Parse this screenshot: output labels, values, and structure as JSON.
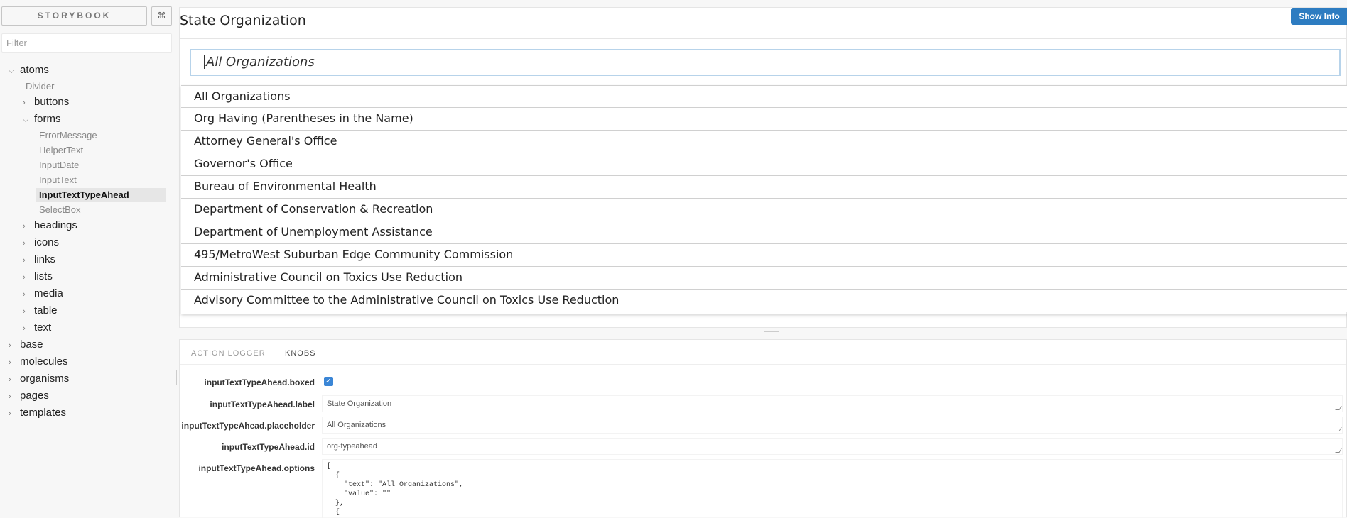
{
  "sidebar": {
    "brand": "STORYBOOK",
    "shortcut": "⌘",
    "filter_placeholder": "Filter",
    "tree": {
      "atoms": "atoms",
      "divider": "Divider",
      "buttons": "buttons",
      "forms": "forms",
      "forms_items": [
        "ErrorMessage",
        "HelperText",
        "InputDate",
        "InputText",
        "InputTextTypeAhead",
        "SelectBox"
      ],
      "headings": "headings",
      "icons": "icons",
      "links": "links",
      "lists": "lists",
      "media": "media",
      "table": "table",
      "text": "text",
      "base": "base",
      "molecules": "molecules",
      "organisms": "organisms",
      "pages": "pages",
      "templates": "templates"
    },
    "selected_story": "InputTextTypeAhead"
  },
  "preview": {
    "title": "State Organization",
    "show_info": "Show Info",
    "input_value": "All Organizations",
    "options": [
      "All Organizations",
      "Org Having (Parentheses in the Name)",
      "Attorney General's Office",
      "Governor's Office",
      "Bureau of Environmental Health",
      "Department of Conservation & Recreation",
      "Department of Unemployment Assistance",
      "495/MetroWest Suburban Edge Community Commission",
      "Administrative Council on Toxics Use Reduction",
      "Advisory Committee to the Administrative Council on Toxics Use Reduction"
    ]
  },
  "panel": {
    "tabs": [
      "ACTION LOGGER",
      "KNOBS"
    ],
    "active_tab": "KNOBS",
    "knobs": {
      "boxed_label": "inputTextTypeAhead.boxed",
      "boxed_checked": true,
      "label_label": "inputTextTypeAhead.label",
      "label_value": "State Organization",
      "placeholder_label": "inputTextTypeAhead.placeholder",
      "placeholder_value": "All Organizations",
      "id_label": "inputTextTypeAhead.id",
      "id_value": "org-typeahead",
      "options_label": "inputTextTypeAhead.options",
      "options_value": "[\n  {\n    \"text\": \"All Organizations\",\n    \"value\": \"\"\n  },\n  {"
    }
  },
  "colors": {
    "accent": "#2d7cc1",
    "input_focus_border": "#b7d3ea",
    "checkbox": "#3b86d6"
  }
}
